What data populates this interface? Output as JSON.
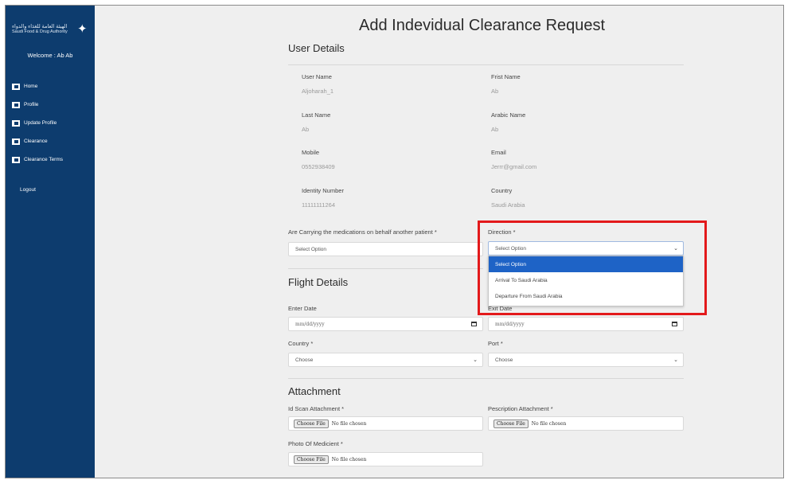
{
  "sidebar": {
    "logo_ar": "الهيئة العامة للغذاء والدواء",
    "logo_en": "Saudi Food & Drug Authority",
    "welcome": "Welcome : Ab Ab",
    "items": [
      {
        "label": "Home"
      },
      {
        "label": "Profile"
      },
      {
        "label": "Update Profile"
      },
      {
        "label": "Clearance"
      },
      {
        "label": "Clearance Terms"
      }
    ],
    "logout": "Logout"
  },
  "page": {
    "title": "Add Indevidual Clearance Request"
  },
  "user_details": {
    "heading": "User Details",
    "fields": [
      {
        "label": "User Name",
        "value": "Aljoharah_1"
      },
      {
        "label": "Frist Name",
        "value": "Ab"
      },
      {
        "label": "Last Name",
        "value": "Ab"
      },
      {
        "label": "Arabic Name",
        "value": "Ab"
      },
      {
        "label": "Mobile",
        "value": "0552938409"
      },
      {
        "label": "Email",
        "value": "Jerrr@gmail.com"
      },
      {
        "label": "Identity Number",
        "value": "11111111264"
      },
      {
        "label": "Country",
        "value": "Saudi Arabia"
      }
    ]
  },
  "medication": {
    "label": "Are Carrying the medications on behalf another patient *",
    "value": "Select Option"
  },
  "direction": {
    "label": "Direction *",
    "value": "Select Option",
    "options": [
      "Select Option",
      "Arrival To Saudi Arabia",
      "Departure From Saudi Arabia"
    ]
  },
  "flight": {
    "heading": "Flight Details",
    "enter_date_label": "Enter Date",
    "enter_date_value": "mm/dd/yyyy",
    "exit_date_label": "Exit Date",
    "exit_date_value": "mm/dd/yyyy",
    "country_label": "Country *",
    "country_value": "Choose",
    "port_label": "Port *",
    "port_value": "Choose"
  },
  "attachment": {
    "heading": "Attachment",
    "id_scan_label": "Id Scan Attachment *",
    "prescription_label": "Pescription Attachment *",
    "photo_label": "Photo Of Medicient *",
    "choose_file": "Choose File",
    "no_file": "No file chosen"
  }
}
